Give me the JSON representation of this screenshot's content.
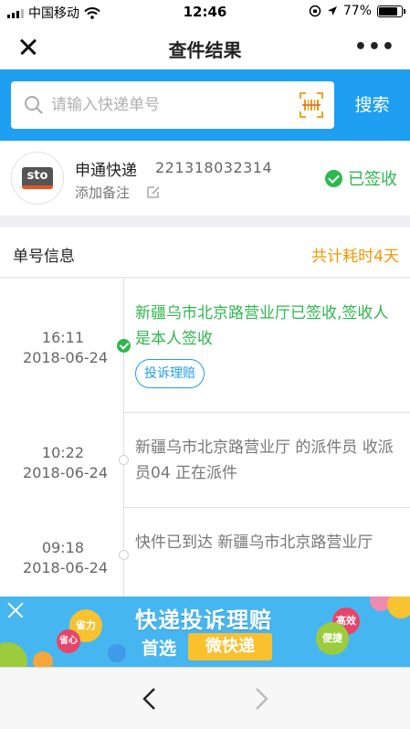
{
  "status_bar": {
    "carrier": "中国移动",
    "time": "12:46",
    "battery": "77%"
  },
  "nav": {
    "title": "查件结果",
    "more": "•••"
  },
  "search": {
    "placeholder": "请输入快递单号",
    "button_label": "搜索"
  },
  "courier": {
    "logo_text": "sto",
    "name": "申通快递",
    "tracking_number": "221318032314",
    "add_note": "添加备注",
    "status": "已签收"
  },
  "info": {
    "title": "单号信息",
    "duration": "共计耗时4天"
  },
  "timeline": [
    {
      "time": "16:11",
      "date": "2018-06-24",
      "text": "新疆乌市北京路营业厅已签收,签收人是本人签收",
      "button": "投诉理赔"
    },
    {
      "time": "10:22",
      "date": "2018-06-24",
      "text": "新疆乌市北京路营业厅 的派件员 收派员04 正在派件"
    },
    {
      "time": "09:18",
      "date": "2018-06-24",
      "text": "快件已到达 新疆乌市北京路营业厅"
    }
  ],
  "ad": {
    "title": "快递投诉理赔",
    "prefix": "首选",
    "cta": "微快递",
    "bubbles": [
      "省力",
      "省心",
      "高效",
      "便捷"
    ]
  },
  "colors": {
    "brand_blue": "#1e9ff2",
    "success_green": "#2db84d",
    "accent_orange": "#f39800"
  }
}
